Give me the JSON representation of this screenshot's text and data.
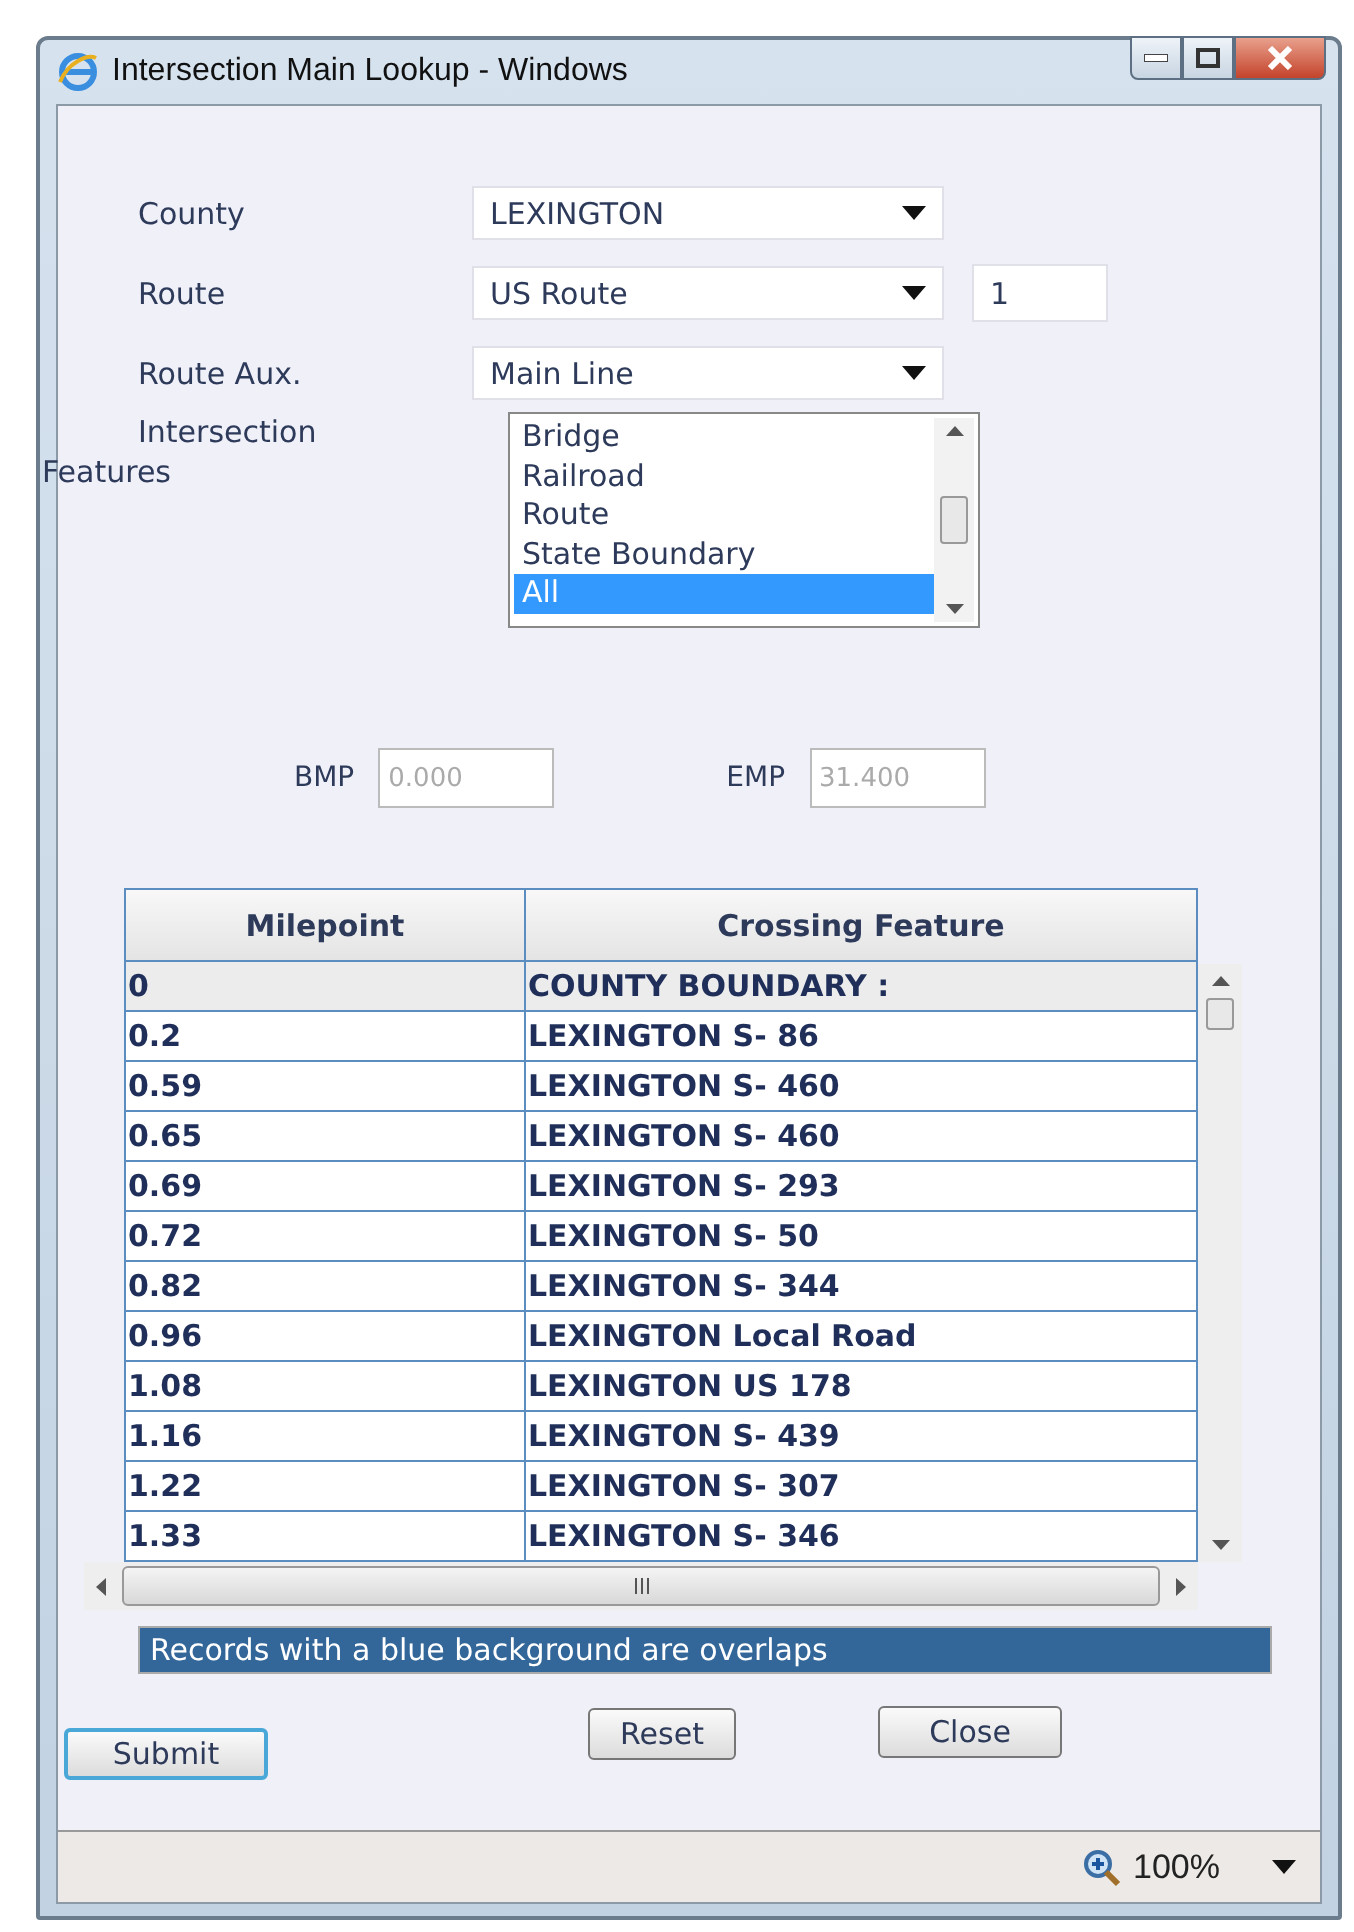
{
  "window": {
    "title": "Intersection Main Lookup - Windows"
  },
  "form": {
    "county": {
      "label": "County",
      "value": "LEXINGTON"
    },
    "route": {
      "label": "Route",
      "value": "US Route",
      "number": "1"
    },
    "route_aux": {
      "label": "Route Aux.",
      "value": "Main Line"
    },
    "features": {
      "label_line_1": "Intersection",
      "label_line_2": "Features",
      "options": [
        {
          "label": "Bridge",
          "selected": false
        },
        {
          "label": "Railroad",
          "selected": false
        },
        {
          "label": "Route",
          "selected": false
        },
        {
          "label": "State Boundary",
          "selected": false
        },
        {
          "label": "All",
          "selected": true
        }
      ]
    },
    "bmp": {
      "label": "BMP",
      "value": "0.000"
    },
    "emp": {
      "label": "EMP",
      "value": "31.400"
    }
  },
  "table": {
    "columns": [
      "Milepoint",
      "Crossing Feature"
    ],
    "rows": [
      {
        "milepoint": "0",
        "feature": "COUNTY BOUNDARY :",
        "selected": true
      },
      {
        "milepoint": "0.2",
        "feature": "LEXINGTON S- 86",
        "selected": false
      },
      {
        "milepoint": "0.59",
        "feature": "LEXINGTON S- 460",
        "selected": false
      },
      {
        "milepoint": "0.65",
        "feature": "LEXINGTON S- 460",
        "selected": false
      },
      {
        "milepoint": "0.69",
        "feature": "LEXINGTON S- 293",
        "selected": false
      },
      {
        "milepoint": "0.72",
        "feature": "LEXINGTON S- 50",
        "selected": false
      },
      {
        "milepoint": "0.82",
        "feature": "LEXINGTON S- 344",
        "selected": false
      },
      {
        "milepoint": "0.96",
        "feature": "LEXINGTON Local Road",
        "selected": false
      },
      {
        "milepoint": "1.08",
        "feature": "LEXINGTON US 178",
        "selected": false
      },
      {
        "milepoint": "1.16",
        "feature": "LEXINGTON S- 439",
        "selected": false
      },
      {
        "milepoint": "1.22",
        "feature": "LEXINGTON S- 307",
        "selected": false
      },
      {
        "milepoint": "1.33",
        "feature": "LEXINGTON S- 346",
        "selected": false
      }
    ]
  },
  "note": "Records with a blue background are overlaps",
  "buttons": {
    "submit": "Submit",
    "reset": "Reset",
    "close": "Close"
  },
  "status_bar": {
    "zoom": "100%"
  }
}
